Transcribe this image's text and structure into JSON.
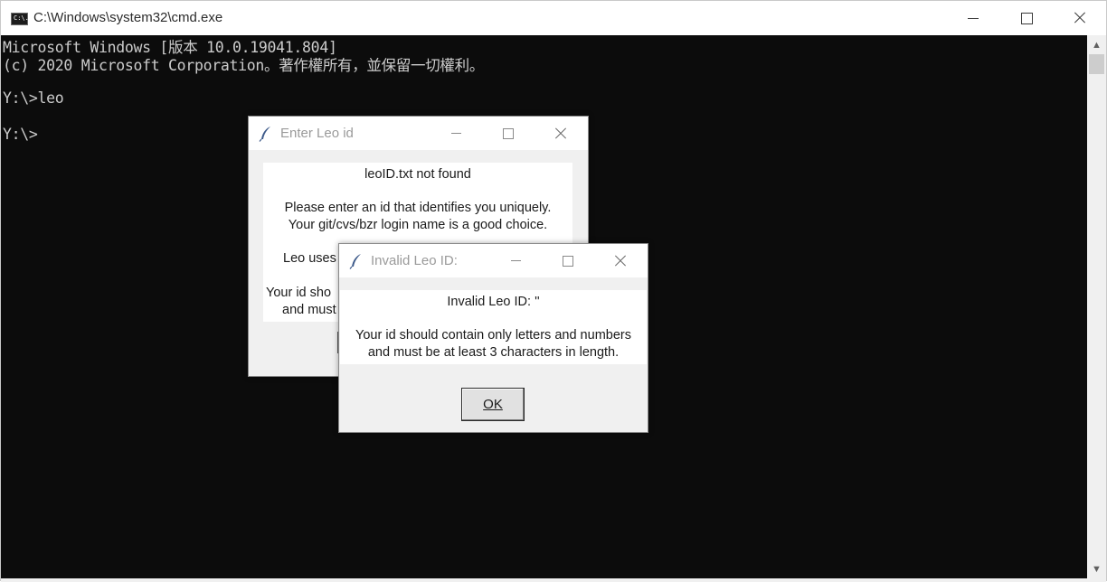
{
  "window": {
    "title": "C:\\Windows\\system32\\cmd.exe",
    "icon_text": "C:\\."
  },
  "console": {
    "lines": [
      "Microsoft Windows [版本 10.0.19041.804]",
      "(c) 2020 Microsoft Corporation。著作權所有，並保留一切權利。",
      "",
      "Y:\\>leo",
      "",
      "Y:\\>"
    ]
  },
  "dialog_enter": {
    "title": "Enter Leo id",
    "lines": [
      "leoID.txt not found",
      "",
      "Please enter an id that identifies you uniquely.",
      "Your git/cvs/bzr login name is a good choice.",
      "",
      "Leo uses",
      "",
      "Your id sho",
      "and must"
    ]
  },
  "dialog_invalid": {
    "title": "Invalid Leo ID:",
    "lines": [
      "Invalid Leo ID: ''",
      "",
      "Your id should contain only letters and numbers",
      "and must be at least 3 characters in length."
    ],
    "ok_label": "OK"
  },
  "icons": {
    "app": "cmd-icon",
    "dialog": "feather-icon"
  },
  "colors": {
    "console_bg": "#0c0c0c",
    "console_text": "#cccccc",
    "dialog_bg": "#f0f0f0"
  }
}
